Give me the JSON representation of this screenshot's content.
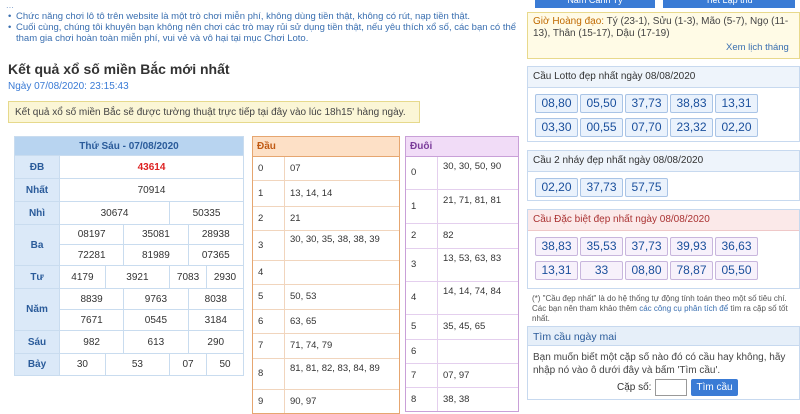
{
  "notice": {
    "line0": "...",
    "item1": "Chức năng chơi lô tô trên website là một trò chơi miễn phí, không dùng tiền thật, không có rút, nạp tiền thật.",
    "item2": "Cuối cùng, chúng tôi khuyên bạn không nên chơi các trò may rủi sử dụng tiền thật, nếu yêu thích xổ số, các bạn có thể tham gia chơi hoàn toàn miễn phí, vui vẻ và vô hại tại mục Chơi Loto."
  },
  "title": "Kết quả xổ số miền Bắc mới nhất",
  "date_line": "Ngày 07/08/2020: 23:15:43",
  "info": "Kết quả xổ số miền Bắc sẽ được tường thuật trực tiếp tại đây vào lúc 18h15' hàng ngày.",
  "results": {
    "header": "Thứ Sáu - 07/08/2020",
    "db_label": "ĐB",
    "db": "43614",
    "nhat_label": "Nhất",
    "nhat": "70914",
    "nhi_label": "Nhì",
    "nhi": [
      "30674",
      "50335"
    ],
    "ba_label": "Ba",
    "ba": [
      "08197",
      "35081",
      "28938",
      "72281",
      "81989",
      "07365"
    ],
    "tu_label": "Tư",
    "tu": [
      "4179",
      "3921",
      "7083",
      "2930"
    ],
    "nam_label": "Năm",
    "nam": [
      "8839",
      "9763",
      "8038",
      "7671",
      "0545",
      "3184"
    ],
    "sau_label": "Sáu",
    "sau": [
      "982",
      "613",
      "290"
    ],
    "bay_label": "Bảy",
    "bay": [
      "30",
      "53",
      "07",
      "50"
    ]
  },
  "dau": {
    "header": "Đầu",
    "rows": [
      {
        "k": "0",
        "v": "07"
      },
      {
        "k": "1",
        "v": "13, 14, 14"
      },
      {
        "k": "2",
        "v": "21"
      },
      {
        "k": "3",
        "v": "30, 30, 35, 38, 38, 39"
      },
      {
        "k": "4",
        "v": ""
      },
      {
        "k": "5",
        "v": "50, 53"
      },
      {
        "k": "6",
        "v": "63, 65"
      },
      {
        "k": "7",
        "v": "71, 74, 79"
      },
      {
        "k": "8",
        "v": "81, 81, 82, 83, 84, 89"
      },
      {
        "k": "9",
        "v": "90, 97"
      }
    ]
  },
  "duoi": {
    "header": "Đuôi",
    "rows": [
      {
        "k": "0",
        "v": "30, 30, 50, 90"
      },
      {
        "k": "1",
        "v": "21, 71, 81, 81"
      },
      {
        "k": "2",
        "v": "82"
      },
      {
        "k": "3",
        "v": "13, 53, 63, 83"
      },
      {
        "k": "4",
        "v": "14, 14, 74, 84"
      },
      {
        "k": "5",
        "v": "35, 45, 65"
      },
      {
        "k": "6",
        "v": ""
      },
      {
        "k": "7",
        "v": "07, 97"
      },
      {
        "k": "8",
        "v": "38, 38"
      }
    ]
  },
  "right": {
    "tab1": "Năm Canh Tý",
    "tab2": "Tiết Lập thu",
    "hoangdao_label": "Giờ Hoàng đạo:",
    "hoangdao_text": "Tý (23-1), Sửu (1-3), Mão (5-7), Ngọ (11-13), Thân (15-17), Dậu (17-19)",
    "lich_link": "Xem lịch tháng",
    "lotto_title": "Cầu Lotto đẹp nhất ngày 08/08/2020",
    "lotto": [
      "08,80",
      "05,50",
      "37,73",
      "38,83",
      "13,31",
      "03,30",
      "00,55",
      "07,70",
      "23,32",
      "02,20"
    ],
    "nhay_title": "Cầu 2 nháy đẹp nhất ngày 08/08/2020",
    "nhay": [
      "02,20",
      "37,73",
      "57,75"
    ],
    "db_title": "Cầu Đặc biệt đẹp nhất ngày 08/08/2020",
    "db": [
      "38,83",
      "35,53",
      "37,73",
      "39,93",
      "36,63",
      "13,31",
      "33",
      "08,80",
      "78,87",
      "05,50"
    ],
    "note_a": "(*) \"Cầu đẹp nhất\" là do hệ thống tự động tính toán theo một số tiêu chí. Các bạn nên tham khảo thêm ",
    "note_link": "các công cụ phân tích để",
    "note_b": " tìm ra cặp số tốt nhất.",
    "find_title": "Tìm cầu ngày mai",
    "find_text": "Bạn muốn biết một cặp số nào đó có cầu hay không, hãy nhập nó vào ô dưới đây và bấm 'Tìm cầu'.",
    "find_label": "Cặp số:",
    "find_button": "Tìm cầu"
  }
}
